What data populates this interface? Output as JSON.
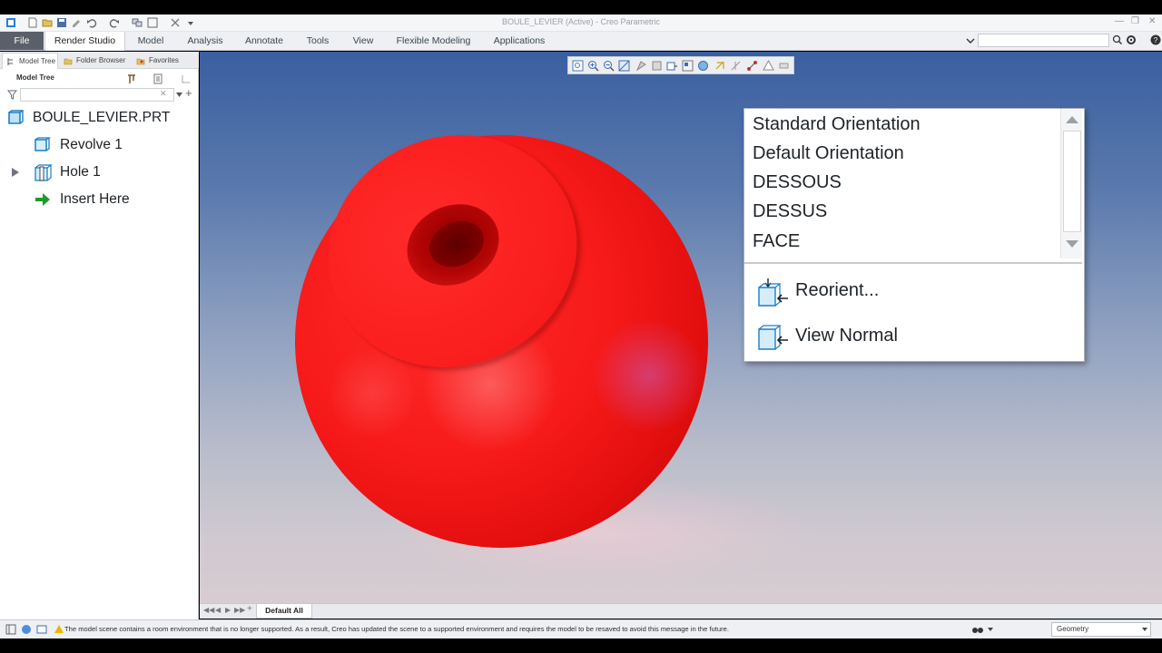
{
  "window": {
    "title": "BOULE_LEVIER (Active) - Creo Parametric"
  },
  "ribbon": {
    "tabs": [
      {
        "label": "File"
      },
      {
        "label": "Render Studio"
      },
      {
        "label": "Model"
      },
      {
        "label": "Analysis"
      },
      {
        "label": "Annotate"
      },
      {
        "label": "Tools"
      },
      {
        "label": "View"
      },
      {
        "label": "Flexible Modeling"
      },
      {
        "label": "Applications"
      }
    ],
    "active_tab": "Render Studio"
  },
  "left_panel": {
    "tabs": [
      {
        "label": "Model Tree"
      },
      {
        "label": "Folder Browser"
      },
      {
        "label": "Favorites"
      }
    ],
    "header": "Model Tree",
    "filter_value": "",
    "tree": [
      {
        "label": "BOULE_LEVIER.PRT",
        "icon": "part-icon"
      },
      {
        "label": "Revolve 1",
        "icon": "revolve-icon"
      },
      {
        "label": "Hole 1",
        "icon": "hole-icon",
        "expandable": true
      },
      {
        "label": "Insert Here",
        "icon": "insert-arrow-icon"
      }
    ]
  },
  "orientation_menu": {
    "saved_views": [
      "Standard Orientation",
      "Default Orientation",
      "DESSOUS",
      "DESSUS",
      "FACE"
    ],
    "actions": [
      {
        "label": "Reorient...",
        "icon": "reorient-icon"
      },
      {
        "label": "View Normal",
        "icon": "view-normal-icon"
      }
    ]
  },
  "bottom_tabs": {
    "active": "Default All"
  },
  "status_bar": {
    "message": "The model scene contains a room environment that is no longer supported.  As a result, Creo has updated the scene to a supported environment and requires the model to be resaved to avoid this message in the future.",
    "selection_filter": "Geometry"
  },
  "colors": {
    "model_red": "#f71a1a",
    "background_top": "#3a5fa0",
    "background_bottom": "#d7ccd1",
    "ribbon_file_bg": "#5a6069"
  }
}
